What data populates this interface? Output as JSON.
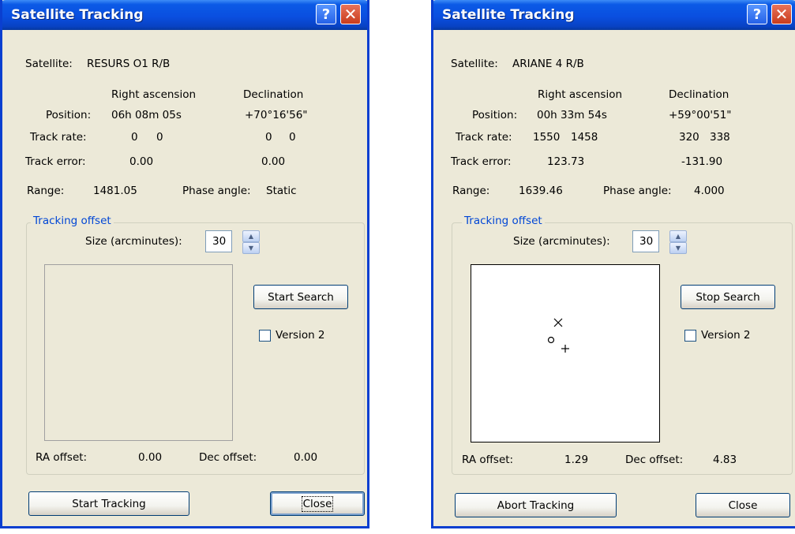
{
  "windows": [
    {
      "title": "Satellite Tracking",
      "satellite_label": "Satellite:",
      "satellite_name": "RESURS O1 R/B",
      "col_ra": "Right ascension",
      "col_dec": "Declination",
      "position_label": "Position:",
      "position_ra": "06h 08m 05s",
      "position_dec": "+70°16'56\"",
      "track_rate_label": "Track rate:",
      "track_rate_ra_1": "0",
      "track_rate_ra_2": "0",
      "track_rate_dec_1": "0",
      "track_rate_dec_2": "0",
      "track_error_label": "Track error:",
      "track_error_ra": "0.00",
      "track_error_dec": "0.00",
      "range_label": "Range:",
      "range_value": "1481.05",
      "phase_label": "Phase angle:",
      "phase_value": "Static",
      "group_label": "Tracking offset",
      "size_label": "Size (arcminutes):",
      "size_value": "30",
      "search_button": "Start Search",
      "version_label": "Version 2",
      "ra_offset_label": "RA offset:",
      "ra_offset_value": "0.00",
      "dec_offset_label": "Dec offset:",
      "dec_offset_value": "0.00",
      "tracking_button": "Start Tracking",
      "close_button": "Close"
    },
    {
      "title": "Satellite Tracking",
      "satellite_label": "Satellite:",
      "satellite_name": "ARIANE 4 R/B",
      "col_ra": "Right ascension",
      "col_dec": "Declination",
      "position_label": "Position:",
      "position_ra": "00h 33m 54s",
      "position_dec": "+59°00'51\"",
      "track_rate_label": "Track rate:",
      "track_rate_ra_1": "1550",
      "track_rate_ra_2": "1458",
      "track_rate_dec_1": "320",
      "track_rate_dec_2": "338",
      "track_error_label": "Track error:",
      "track_error_ra": "123.73",
      "track_error_dec": "-131.90",
      "range_label": "Range:",
      "range_value": "1639.46",
      "phase_label": "Phase angle:",
      "phase_value": "4.000",
      "group_label": "Tracking offset",
      "size_label": "Size (arcminutes):",
      "size_value": "30",
      "search_button": "Stop Search",
      "version_label": "Version 2",
      "ra_offset_label": "RA offset:",
      "ra_offset_value": "1.29",
      "dec_offset_label": "Dec offset:",
      "dec_offset_value": "4.83",
      "tracking_button": "Abort Tracking",
      "close_button": "Close",
      "markers": [
        "x-marker",
        "circle-marker",
        "plus-marker"
      ]
    }
  ],
  "icons": {
    "help": "?",
    "close": "✕",
    "spin_up": "▲",
    "spin_down": "▼"
  },
  "colors": {
    "titlebar": "#0a4fe0",
    "dialog_bg": "#ece9d8",
    "group_label": "#0046d5"
  }
}
